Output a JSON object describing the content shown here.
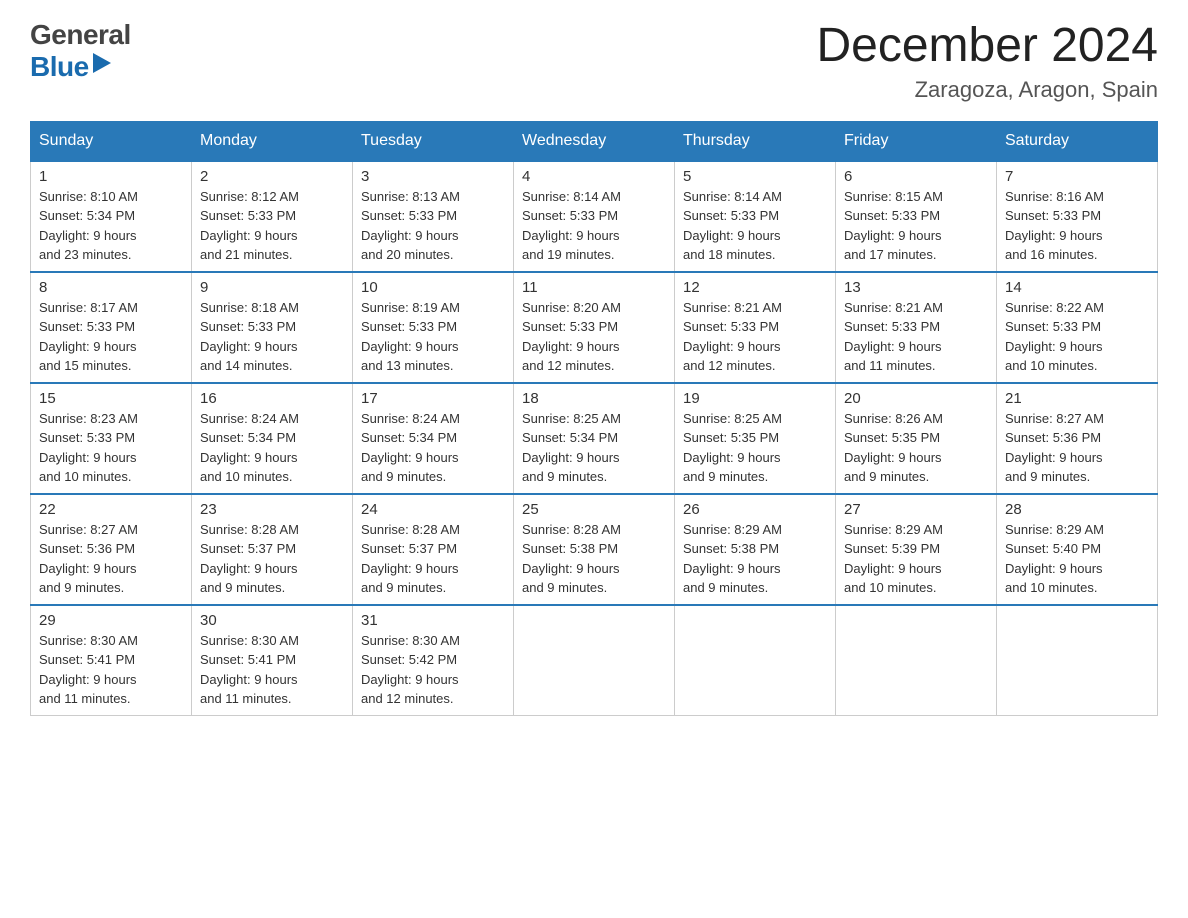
{
  "header": {
    "logo_line1": "General",
    "logo_line2": "Blue",
    "month_title": "December 2024",
    "location": "Zaragoza, Aragon, Spain"
  },
  "weekdays": [
    "Sunday",
    "Monday",
    "Tuesday",
    "Wednesday",
    "Thursday",
    "Friday",
    "Saturday"
  ],
  "weeks": [
    [
      {
        "day": "1",
        "sunrise": "8:10 AM",
        "sunset": "5:34 PM",
        "daylight": "9 hours and 23 minutes."
      },
      {
        "day": "2",
        "sunrise": "8:12 AM",
        "sunset": "5:33 PM",
        "daylight": "9 hours and 21 minutes."
      },
      {
        "day": "3",
        "sunrise": "8:13 AM",
        "sunset": "5:33 PM",
        "daylight": "9 hours and 20 minutes."
      },
      {
        "day": "4",
        "sunrise": "8:14 AM",
        "sunset": "5:33 PM",
        "daylight": "9 hours and 19 minutes."
      },
      {
        "day": "5",
        "sunrise": "8:14 AM",
        "sunset": "5:33 PM",
        "daylight": "9 hours and 18 minutes."
      },
      {
        "day": "6",
        "sunrise": "8:15 AM",
        "sunset": "5:33 PM",
        "daylight": "9 hours and 17 minutes."
      },
      {
        "day": "7",
        "sunrise": "8:16 AM",
        "sunset": "5:33 PM",
        "daylight": "9 hours and 16 minutes."
      }
    ],
    [
      {
        "day": "8",
        "sunrise": "8:17 AM",
        "sunset": "5:33 PM",
        "daylight": "9 hours and 15 minutes."
      },
      {
        "day": "9",
        "sunrise": "8:18 AM",
        "sunset": "5:33 PM",
        "daylight": "9 hours and 14 minutes."
      },
      {
        "day": "10",
        "sunrise": "8:19 AM",
        "sunset": "5:33 PM",
        "daylight": "9 hours and 13 minutes."
      },
      {
        "day": "11",
        "sunrise": "8:20 AM",
        "sunset": "5:33 PM",
        "daylight": "9 hours and 12 minutes."
      },
      {
        "day": "12",
        "sunrise": "8:21 AM",
        "sunset": "5:33 PM",
        "daylight": "9 hours and 12 minutes."
      },
      {
        "day": "13",
        "sunrise": "8:21 AM",
        "sunset": "5:33 PM",
        "daylight": "9 hours and 11 minutes."
      },
      {
        "day": "14",
        "sunrise": "8:22 AM",
        "sunset": "5:33 PM",
        "daylight": "9 hours and 10 minutes."
      }
    ],
    [
      {
        "day": "15",
        "sunrise": "8:23 AM",
        "sunset": "5:33 PM",
        "daylight": "9 hours and 10 minutes."
      },
      {
        "day": "16",
        "sunrise": "8:24 AM",
        "sunset": "5:34 PM",
        "daylight": "9 hours and 10 minutes."
      },
      {
        "day": "17",
        "sunrise": "8:24 AM",
        "sunset": "5:34 PM",
        "daylight": "9 hours and 9 minutes."
      },
      {
        "day": "18",
        "sunrise": "8:25 AM",
        "sunset": "5:34 PM",
        "daylight": "9 hours and 9 minutes."
      },
      {
        "day": "19",
        "sunrise": "8:25 AM",
        "sunset": "5:35 PM",
        "daylight": "9 hours and 9 minutes."
      },
      {
        "day": "20",
        "sunrise": "8:26 AM",
        "sunset": "5:35 PM",
        "daylight": "9 hours and 9 minutes."
      },
      {
        "day": "21",
        "sunrise": "8:27 AM",
        "sunset": "5:36 PM",
        "daylight": "9 hours and 9 minutes."
      }
    ],
    [
      {
        "day": "22",
        "sunrise": "8:27 AM",
        "sunset": "5:36 PM",
        "daylight": "9 hours and 9 minutes."
      },
      {
        "day": "23",
        "sunrise": "8:28 AM",
        "sunset": "5:37 PM",
        "daylight": "9 hours and 9 minutes."
      },
      {
        "day": "24",
        "sunrise": "8:28 AM",
        "sunset": "5:37 PM",
        "daylight": "9 hours and 9 minutes."
      },
      {
        "day": "25",
        "sunrise": "8:28 AM",
        "sunset": "5:38 PM",
        "daylight": "9 hours and 9 minutes."
      },
      {
        "day": "26",
        "sunrise": "8:29 AM",
        "sunset": "5:38 PM",
        "daylight": "9 hours and 9 minutes."
      },
      {
        "day": "27",
        "sunrise": "8:29 AM",
        "sunset": "5:39 PM",
        "daylight": "9 hours and 10 minutes."
      },
      {
        "day": "28",
        "sunrise": "8:29 AM",
        "sunset": "5:40 PM",
        "daylight": "9 hours and 10 minutes."
      }
    ],
    [
      {
        "day": "29",
        "sunrise": "8:30 AM",
        "sunset": "5:41 PM",
        "daylight": "9 hours and 11 minutes."
      },
      {
        "day": "30",
        "sunrise": "8:30 AM",
        "sunset": "5:41 PM",
        "daylight": "9 hours and 11 minutes."
      },
      {
        "day": "31",
        "sunrise": "8:30 AM",
        "sunset": "5:42 PM",
        "daylight": "9 hours and 12 minutes."
      },
      null,
      null,
      null,
      null
    ]
  ],
  "labels": {
    "sunrise": "Sunrise:",
    "sunset": "Sunset:",
    "daylight": "Daylight:"
  }
}
